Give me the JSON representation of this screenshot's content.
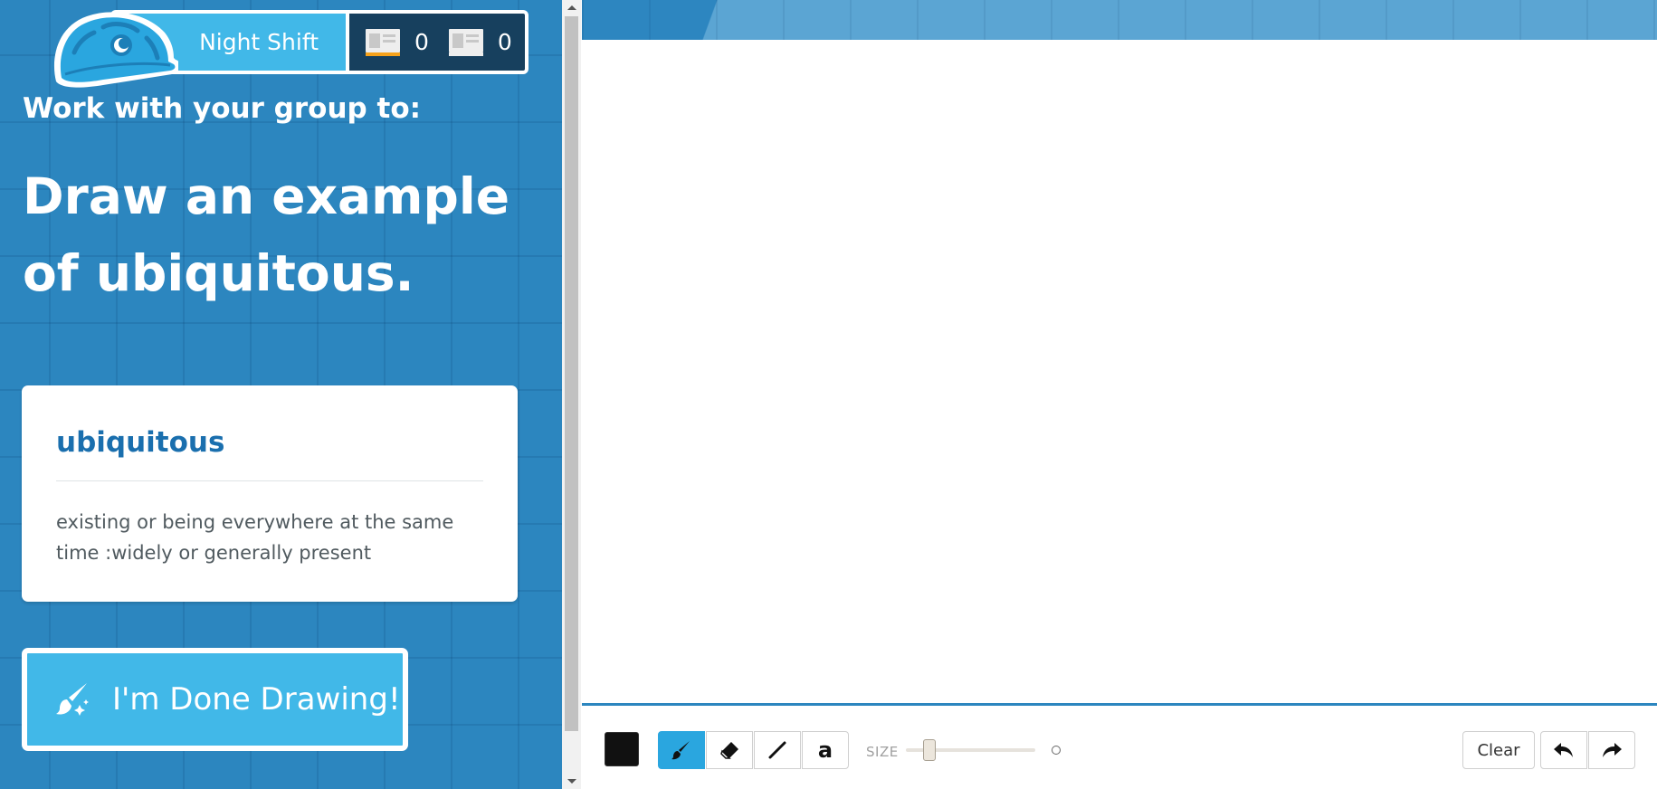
{
  "header": {
    "shift_name": "Night Shift",
    "stats": [
      {
        "icon": "card-icon-orange",
        "count": "0"
      },
      {
        "icon": "card-icon",
        "count": "0"
      }
    ]
  },
  "task": {
    "instruction": "Work with your group to:",
    "prompt": "Draw an example of ubiquitous."
  },
  "definition": {
    "word": "ubiquitous",
    "meaning": "existing or being everywhere at the same time :widely or generally present"
  },
  "done_button": {
    "label": "I'm Done Drawing!",
    "icon": "paintbrush-sparkle-icon"
  },
  "toolbar": {
    "color": "#111111",
    "tools": [
      {
        "name": "brush",
        "icon": "brush-icon",
        "active": true
      },
      {
        "name": "eraser",
        "icon": "eraser-icon",
        "active": false
      },
      {
        "name": "line",
        "icon": "line-icon",
        "active": false
      },
      {
        "name": "text",
        "icon": "text-icon",
        "glyph": "a",
        "active": false
      }
    ],
    "size_label": "SIZE",
    "clear_label": "Clear",
    "undo_icon": "undo-icon",
    "redo_icon": "redo-icon"
  },
  "colors": {
    "panel_blue": "#2c86bf",
    "accent_light_blue": "#41b8e8",
    "dark_navy": "#17405e",
    "word_blue": "#1a6fae",
    "orange": "#f6a21b"
  }
}
